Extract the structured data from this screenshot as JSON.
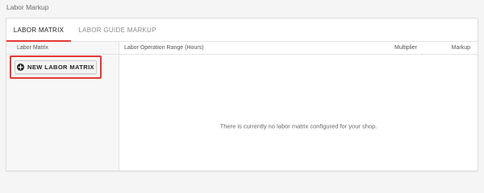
{
  "page": {
    "title": "Labor Markup"
  },
  "tabs": [
    {
      "label": "LABOR MATRIX",
      "active": true
    },
    {
      "label": "LABOR GUIDE MARKUP",
      "active": false
    }
  ],
  "sidebar": {
    "header": "Labor Matrix",
    "new_button_label": "NEW LABOR MATRIX",
    "new_button_icon": "plus-circle-icon"
  },
  "table": {
    "columns": {
      "range": "Labor Operation Range (Hours)",
      "multiplier": "Multiplier",
      "markup": "Markup"
    },
    "empty_message": "There is currently no labor matrix configured for your shop."
  },
  "colors": {
    "accent": "#e53935",
    "highlight_box": "#e53935"
  }
}
